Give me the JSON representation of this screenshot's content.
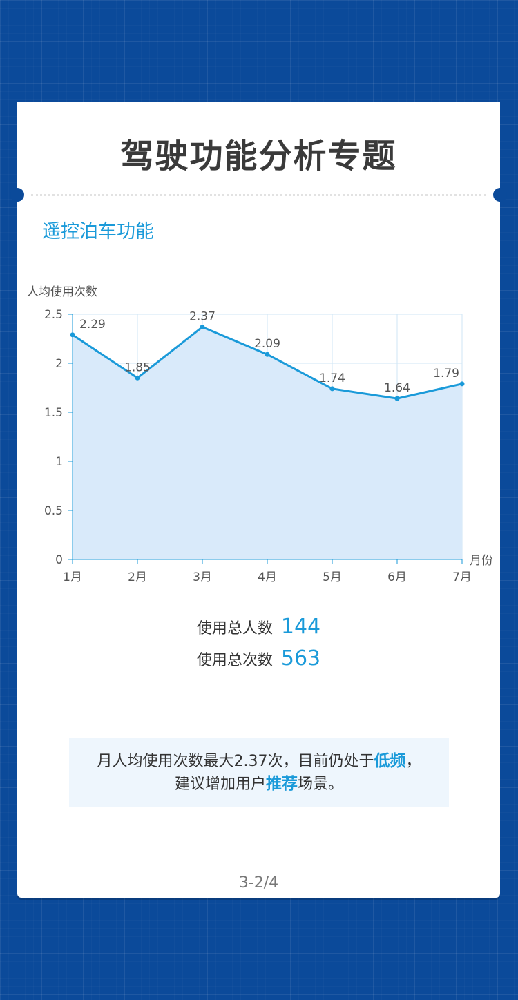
{
  "header": {
    "title": "驾驶功能分析专题"
  },
  "section": {
    "title": "遥控泊车功能"
  },
  "chart_data": {
    "type": "area",
    "title": "",
    "ylabel": "人均使用次数",
    "xlabel": "月份",
    "categories": [
      "1月",
      "2月",
      "3月",
      "4月",
      "5月",
      "6月",
      "7月"
    ],
    "values": [
      2.29,
      1.85,
      2.37,
      2.09,
      1.74,
      1.64,
      1.79
    ],
    "value_labels": [
      "2.29",
      "1.85",
      "2.37",
      "2.09",
      "1.74",
      "1.64",
      "1.79"
    ],
    "ylim": [
      0,
      2.5
    ],
    "yticks": [
      0,
      0.5,
      1,
      1.5,
      2,
      2.5
    ],
    "ytick_labels": [
      "0",
      "0.5",
      "1",
      "1.5",
      "2",
      "2.5"
    ],
    "grid": true,
    "line_color": "#1a9ad9",
    "fill_color": "#d9eafa"
  },
  "stats": {
    "users_label": "使用总人数",
    "users_value": "144",
    "count_label": "使用总次数",
    "count_value": "563"
  },
  "note": {
    "line1_a": "月人均使用次数最大2.37次，目前仍处于",
    "line1_hl": "低频",
    "line1_b": "，",
    "line2_a": "建议增加用户",
    "line2_hl": "推荐",
    "line2_b": "场景。"
  },
  "footer": {
    "page": "3-2/4"
  },
  "colors": {
    "background": "#0b4a9a",
    "accent": "#1a9ad9"
  }
}
